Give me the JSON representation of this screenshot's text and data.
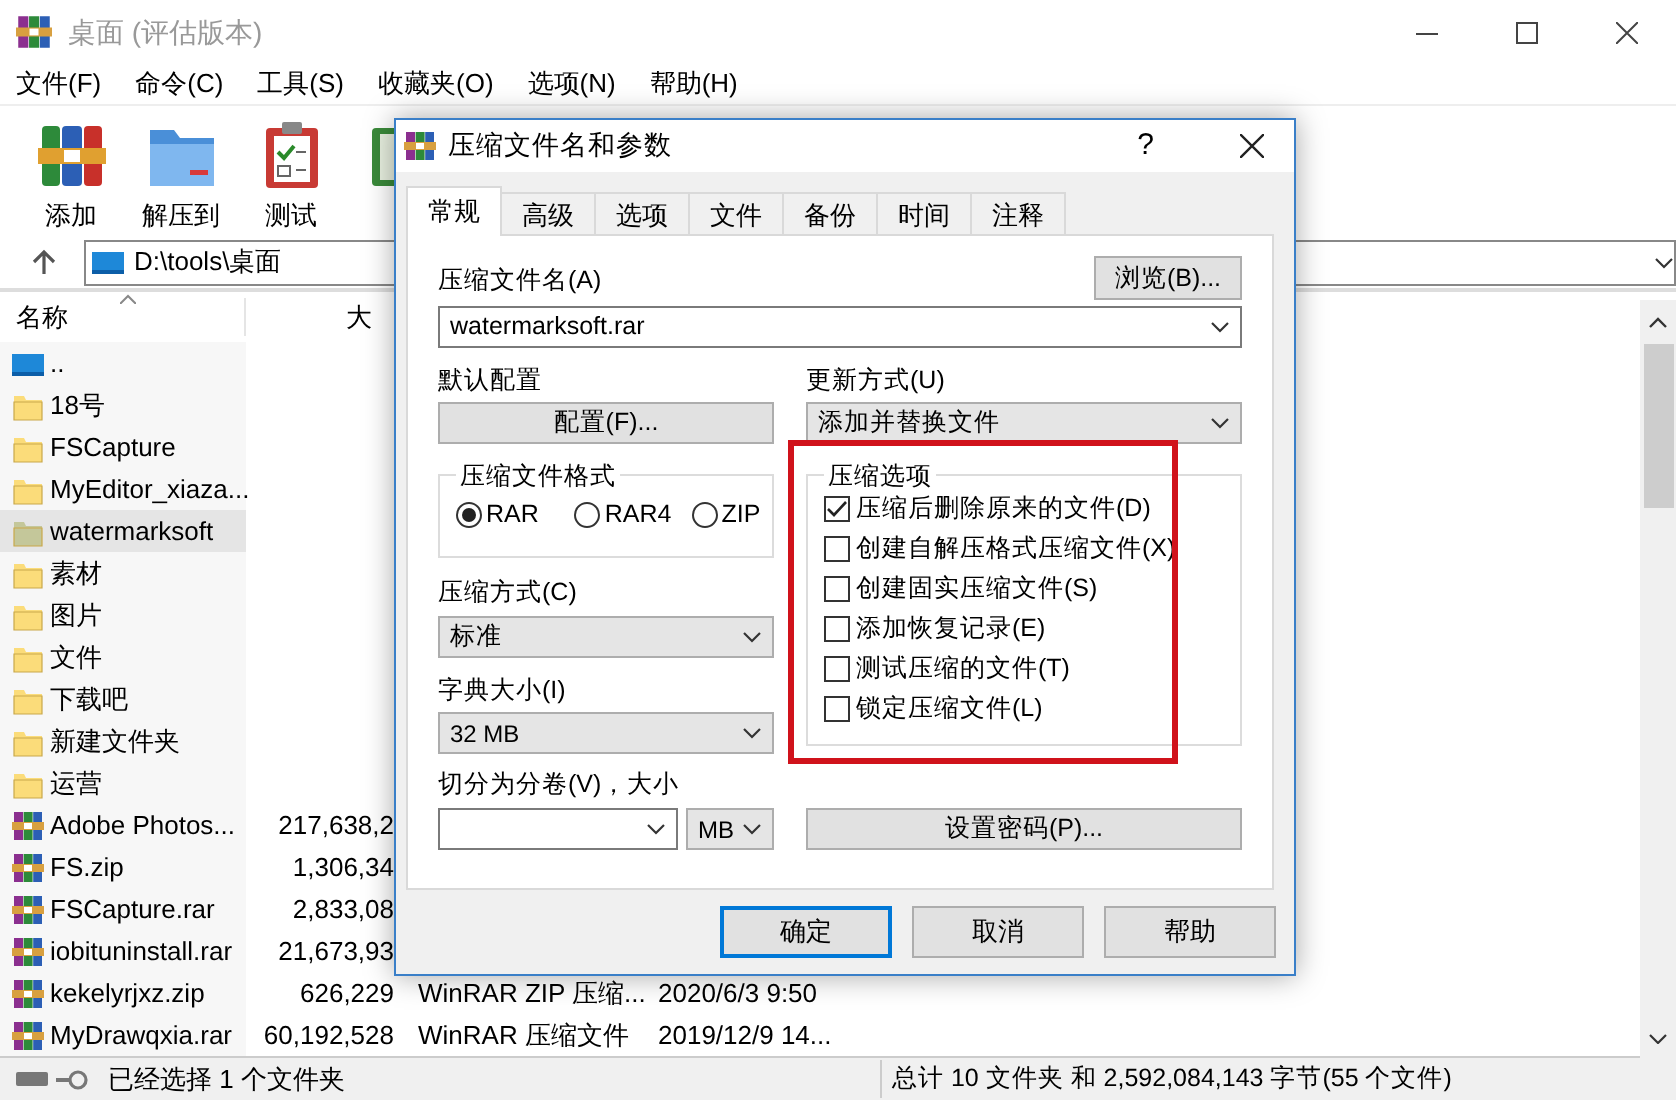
{
  "window": {
    "title": "桌面 (评估版本)"
  },
  "menu": [
    "文件(F)",
    "命令(C)",
    "工具(S)",
    "收藏夹(O)",
    "选项(N)",
    "帮助(H)"
  ],
  "toolbar": [
    {
      "label": "添加",
      "kind": "add"
    },
    {
      "label": "解压到",
      "kind": "extract"
    },
    {
      "label": "测试",
      "kind": "test"
    },
    {
      "kind": "view"
    }
  ],
  "address": {
    "path": "D:\\tools\\桌面"
  },
  "file_list": {
    "columns": [
      "名称",
      "大"
    ],
    "rows": [
      {
        "name": "..",
        "kind": "up",
        "selected": false
      },
      {
        "name": "18号",
        "kind": "folder",
        "selected": false
      },
      {
        "name": "FSCapture",
        "kind": "folder",
        "selected": false
      },
      {
        "name": "MyEditor_xiaza...",
        "kind": "folder",
        "selected": false
      },
      {
        "name": "watermarksoft",
        "kind": "folder",
        "selected": true
      },
      {
        "name": "素材",
        "kind": "folder",
        "selected": false
      },
      {
        "name": "图片",
        "kind": "folder",
        "selected": false
      },
      {
        "name": "文件",
        "kind": "folder",
        "selected": false
      },
      {
        "name": "下载吧",
        "kind": "folder",
        "selected": false
      },
      {
        "name": "新建文件夹",
        "kind": "folder",
        "selected": false
      },
      {
        "name": "运营",
        "kind": "folder",
        "selected": false
      },
      {
        "name": "Adobe Photos...",
        "kind": "archive",
        "size": "217,638,2",
        "selected": false
      },
      {
        "name": "FS.zip",
        "kind": "archive",
        "size": "1,306,34",
        "selected": false
      },
      {
        "name": "FSCapture.rar",
        "kind": "archive",
        "size": "2,833,08",
        "selected": false
      },
      {
        "name": "iobituninstall.rar",
        "kind": "archive",
        "size": "21,673,93",
        "selected": false
      },
      {
        "name": "kekelyrjxz.zip",
        "kind": "archive",
        "size": "626,229",
        "type": "WinRAR ZIP 压缩...",
        "modified": "2020/6/3 9:50",
        "selected": false
      },
      {
        "name": "MyDrawqxia.rar",
        "kind": "archive",
        "size": "60,192,528",
        "type": "WinRAR 压缩文件",
        "modified": "2019/12/9 14...",
        "selected": false
      }
    ]
  },
  "status_bar": {
    "left": "已经选择 1 个文件夹",
    "right": "总计 10 文件夹 和 2,592,084,143 字节(55 个文件)"
  },
  "dialog": {
    "title": "压缩文件名和参数",
    "help": "?",
    "tabs": [
      {
        "label": "常规",
        "selected": true
      },
      {
        "label": "高级",
        "selected": false
      },
      {
        "label": "选项",
        "selected": false
      },
      {
        "label": "文件",
        "selected": false
      },
      {
        "label": "备份",
        "selected": false
      },
      {
        "label": "时间",
        "selected": false
      },
      {
        "label": "注释",
        "selected": false
      }
    ],
    "archive_name": {
      "label": "压缩文件名(A)",
      "value": "watermarksoft.rar",
      "browse": "浏览(B)..."
    },
    "profile": {
      "label": "默认配置",
      "button": "配置(F)..."
    },
    "update_mode": {
      "label": "更新方式(U)",
      "value": "添加并替换文件"
    },
    "format": {
      "title": "压缩文件格式",
      "options": [
        {
          "label": "RAR",
          "selected": true
        },
        {
          "label": "RAR4",
          "selected": false
        },
        {
          "label": "ZIP",
          "selected": false
        }
      ]
    },
    "method": {
      "label": "压缩方式(C)",
      "value": "标准"
    },
    "dictionary": {
      "label": "字典大小(I)",
      "value": "32 MB"
    },
    "volumes": {
      "label": "切分为分卷(V)，大小",
      "unit": "MB"
    },
    "options": {
      "title": "压缩选项",
      "highlighted": true,
      "items": [
        {
          "label": "压缩后删除原来的文件(D)",
          "checked": true
        },
        {
          "label": "创建自解压格式压缩文件(X)",
          "checked": false
        },
        {
          "label": "创建固实压缩文件(S)",
          "checked": false
        },
        {
          "label": "添加恢复记录(E)",
          "checked": false
        },
        {
          "label": "测试压缩的文件(T)",
          "checked": false
        },
        {
          "label": "锁定压缩文件(L)",
          "checked": false
        }
      ]
    },
    "password_button": "设置密码(P)...",
    "buttons": [
      {
        "label": "确定",
        "default": true
      },
      {
        "label": "取消",
        "default": false
      },
      {
        "label": "帮助",
        "default": false
      }
    ]
  }
}
